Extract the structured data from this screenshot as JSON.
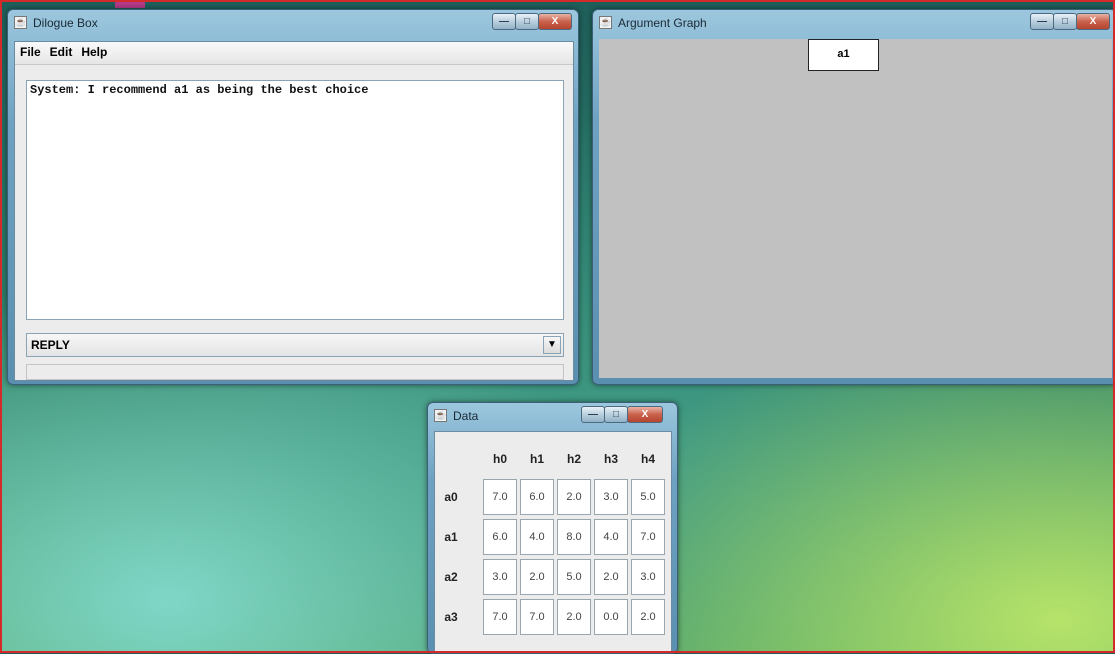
{
  "dialogue_window": {
    "title": "Dilogue Box",
    "menu": [
      "File",
      "Edit",
      "Help"
    ],
    "transcript": "System: I recommend a1 as being the best choice",
    "reply_combo_value": "REPLY",
    "controls": {
      "minimize": "—",
      "maximize": "□",
      "close": "X"
    }
  },
  "graph_window": {
    "title": "Argument Graph",
    "nodes": [
      {
        "label": "a1"
      }
    ]
  },
  "data_window": {
    "title": "Data",
    "column_headers": [
      "h0",
      "h1",
      "h2",
      "h3",
      "h4"
    ],
    "rows": [
      {
        "label": "a0",
        "values": [
          "7.0",
          "6.0",
          "2.0",
          "3.0",
          "5.0"
        ]
      },
      {
        "label": "a1",
        "values": [
          "6.0",
          "4.0",
          "8.0",
          "4.0",
          "7.0"
        ]
      },
      {
        "label": "a2",
        "values": [
          "3.0",
          "2.0",
          "5.0",
          "2.0",
          "3.0"
        ]
      },
      {
        "label": "a3",
        "values": [
          "7.0",
          "7.0",
          "2.0",
          "0.0",
          "2.0"
        ]
      }
    ]
  },
  "colors": {
    "desktop_border": "#d42a2a",
    "graph_background": "#c1c1c1"
  },
  "icons": [
    "java-icon",
    "minimize-icon",
    "maximize-icon",
    "close-icon",
    "dropdown-arrow-icon"
  ]
}
